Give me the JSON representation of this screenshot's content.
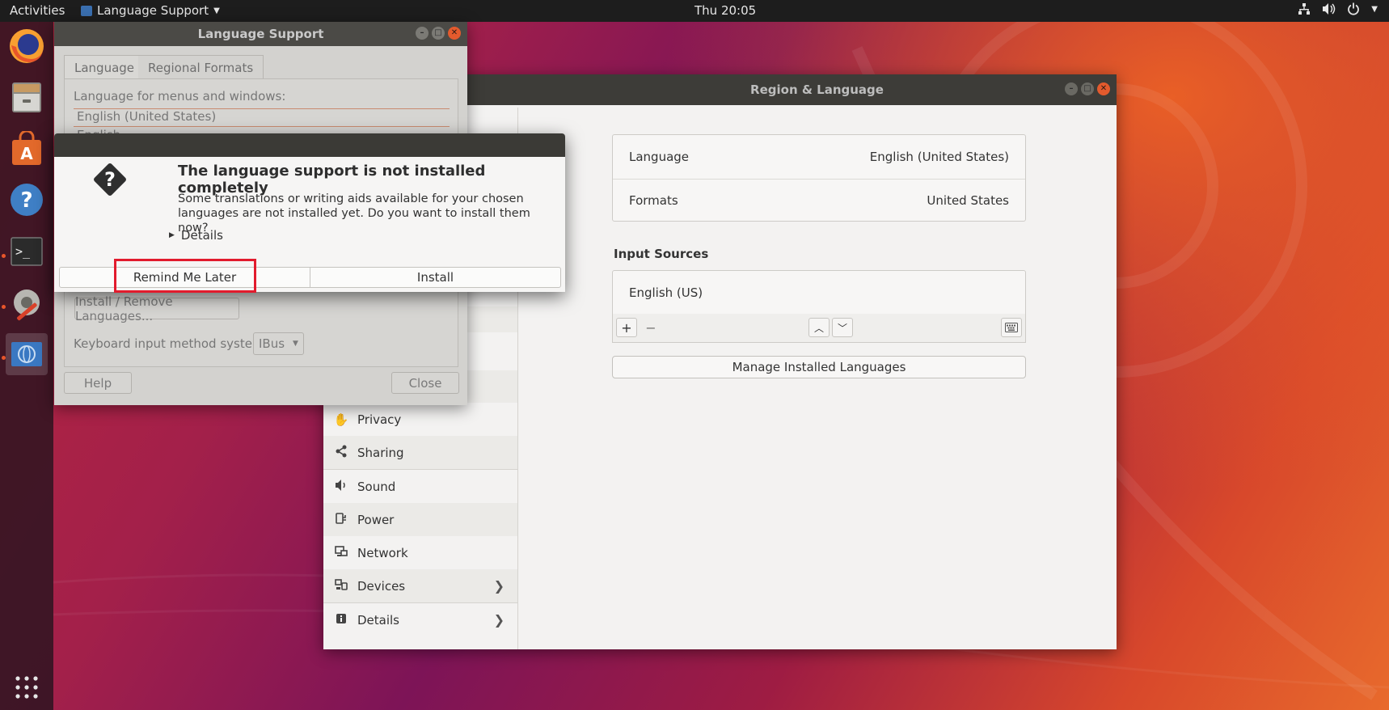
{
  "topbar": {
    "activities": "Activities",
    "app_menu": "Language Support",
    "clock": "Thu 20:05"
  },
  "dock": {
    "items": [
      "Firefox",
      "Files",
      "Ubuntu Software",
      "Help",
      "Terminal",
      "Settings",
      "Language Support",
      "Show Applications"
    ]
  },
  "region_window": {
    "title": "Region & Language",
    "sidebar": [
      {
        "label": "Privacy",
        "icon": "hand-icon"
      },
      {
        "label": "Sharing",
        "icon": "share-icon"
      },
      {
        "label": "Sound",
        "icon": "speaker-icon"
      },
      {
        "label": "Power",
        "icon": "power-plug-icon"
      },
      {
        "label": "Network",
        "icon": "network-icon"
      },
      {
        "label": "Devices",
        "icon": "devices-icon"
      },
      {
        "label": "Details",
        "icon": "info-icon"
      }
    ],
    "language_label": "Language",
    "language_value": "English (United States)",
    "formats_label": "Formats",
    "formats_value": "United States",
    "input_sources_heading": "Input Sources",
    "input_source": "English (US)",
    "manage_button": "Manage Installed Languages"
  },
  "language_support_window": {
    "title": "Language Support",
    "tabs": [
      "Language",
      "Regional Formats"
    ],
    "menus_label": "Language for menus and windows:",
    "language_item": "English (United States)",
    "partial_item": "English",
    "install_remove_button": "Install / Remove Languages...",
    "keyboard_label": "Keyboard input method system:",
    "keyboard_value": "IBus",
    "help_button": "Help",
    "close_button": "Close"
  },
  "dialog": {
    "heading": "The language support is not installed completely",
    "body_line1": "Some translations or writing aids available for your chosen",
    "body_line2": "languages are not installed yet. Do you want to install them now?",
    "details": "Details",
    "remind_button": "Remind Me Later",
    "install_button": "Install"
  },
  "colors": {
    "accent": "#e95420",
    "highlight_box": "#e21b2d"
  }
}
